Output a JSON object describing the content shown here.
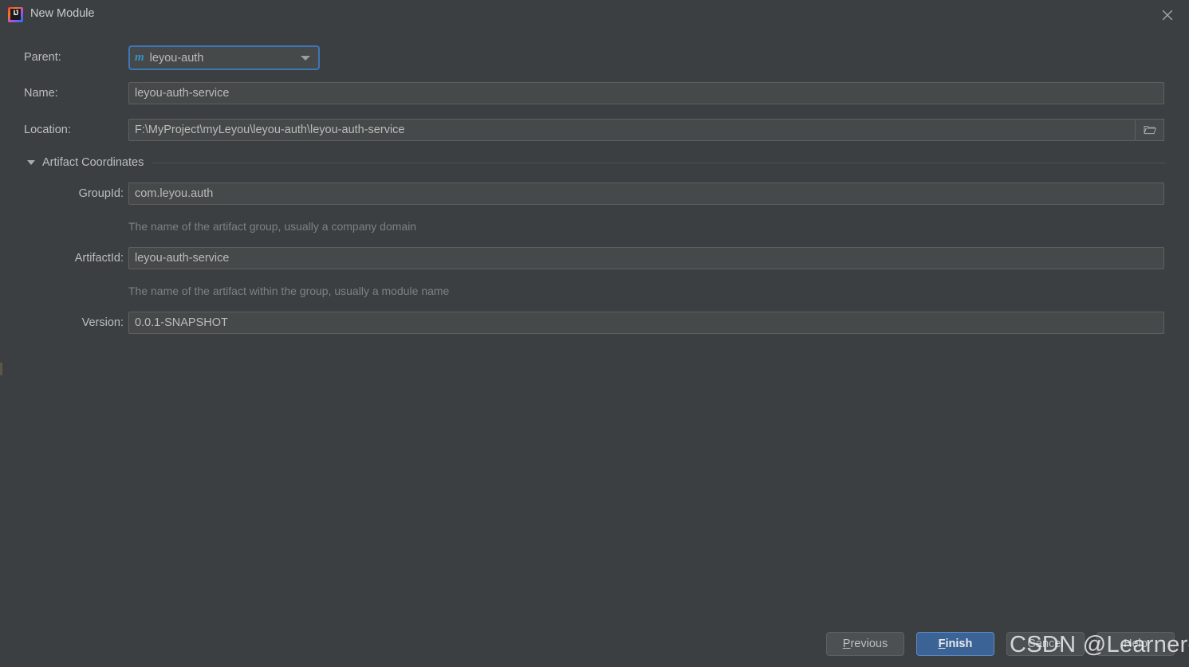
{
  "window": {
    "title": "New Module",
    "app_icon": "intellij-idea-logo",
    "app_icon_glyph": "IJ",
    "close_icon": "close-icon"
  },
  "form": {
    "parent": {
      "label": "Parent:",
      "value": "leyou-auth",
      "icon": "maven-module-icon",
      "icon_glyph": "m",
      "dropdown_icon": "chevron-down-icon"
    },
    "name": {
      "label": "Name:",
      "value": "leyou-auth-service"
    },
    "location": {
      "label": "Location:",
      "value": "F:\\MyProject\\myLeyou\\leyou-auth\\leyou-auth-service",
      "browse_icon": "folder-icon"
    }
  },
  "artifact_coordinates": {
    "section_title": "Artifact Coordinates",
    "expanded": true,
    "toggle_icon": "triangle-down-icon",
    "group_id": {
      "label": "GroupId:",
      "value": "com.leyou.auth",
      "hint": "The name of the artifact group, usually a company domain"
    },
    "artifact_id": {
      "label": "ArtifactId:",
      "value": "leyou-auth-service",
      "hint": "The name of the artifact within the group, usually a module name"
    },
    "version": {
      "label": "Version:",
      "value": "0.0.1-SNAPSHOT"
    }
  },
  "buttons": {
    "previous": {
      "label": "Previous",
      "mnemonic": "P",
      "rest": "revious"
    },
    "finish": {
      "label": "Finish",
      "mnemonic": "F",
      "rest": "inish",
      "is_default": true
    },
    "cancel": {
      "label": "Cancel"
    },
    "help": {
      "label": "Help"
    }
  },
  "watermark": {
    "text": "CSDN @Learner-Wang"
  },
  "colors": {
    "background": "#3C3F41",
    "field_background": "#45494A",
    "field_border": "#5E6060",
    "focus_border": "#3D76B6",
    "default_button": "#3C6395",
    "text": "#BBBBBB",
    "hint_text": "#7E8183",
    "maven_icon": "#3592C4"
  }
}
